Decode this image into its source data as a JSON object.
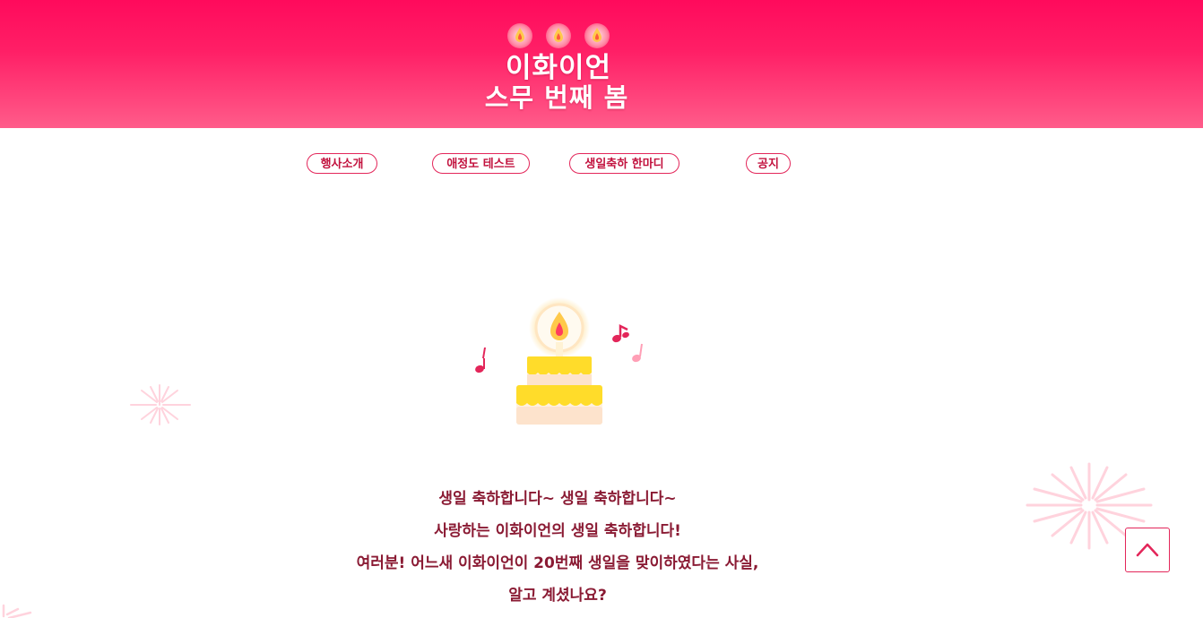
{
  "hero": {
    "title_line1": "이화이언",
    "title_line2": "스무 번째 봄",
    "candle_icon": "candle-flame-icon",
    "bg_color": "#ff0a5c"
  },
  "nav": {
    "items": [
      {
        "label": "행사소개"
      },
      {
        "label": "애정도 테스트"
      },
      {
        "label": "생일축하 한마디"
      },
      {
        "label": "공지"
      }
    ],
    "accent_color": "#e3265a"
  },
  "illustration": {
    "icon": "birthday-cake-icon",
    "notes_icon": "music-note-icon",
    "firework_icon": "firework-icon"
  },
  "message": {
    "line1": "생일 축하합니다~ 생일 축하합니다~",
    "line2": "사랑하는 이화이언의 생일 축하합니다!",
    "line3": "여러분! 어느새 이화이언이 20번째 생일을 맞이하였다는 사실,",
    "line4": "알고 계셨나요?",
    "text_color": "#8a1a33"
  },
  "scroll_top": {
    "icon": "chevron-up-icon"
  }
}
